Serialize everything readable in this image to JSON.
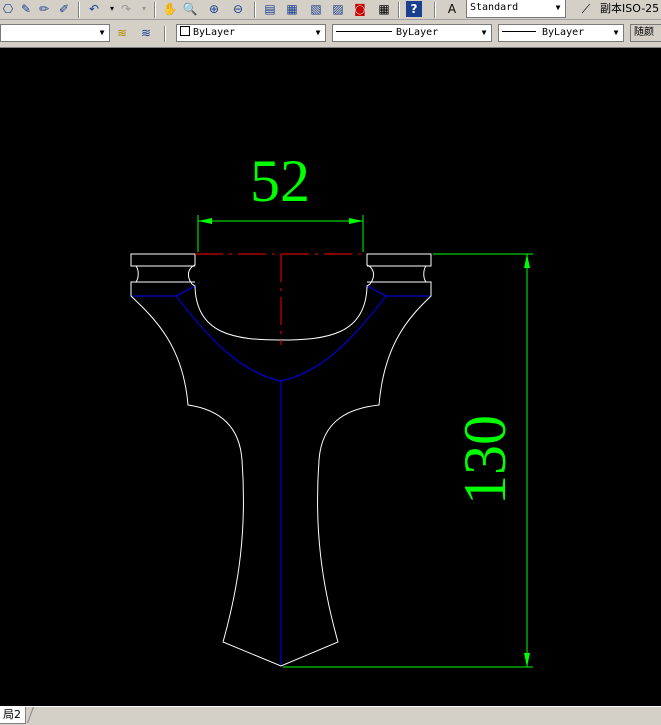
{
  "toolbar": {
    "text_style": "Standard",
    "dim_style": "副本ISO-25"
  },
  "properties": {
    "layer_value": "",
    "color": "ByLayer",
    "linetype": "ByLayer",
    "lineweight": "ByLayer",
    "plot_style": "随颜"
  },
  "drawing": {
    "dim_width": "52",
    "dim_height": "130"
  },
  "layout_tab": "局2",
  "colors": {
    "canvas": "#000000",
    "outline": "#ffffff",
    "dimension": "#00ff00",
    "centerline": "#ff0000",
    "hidden": "#0000ff"
  }
}
